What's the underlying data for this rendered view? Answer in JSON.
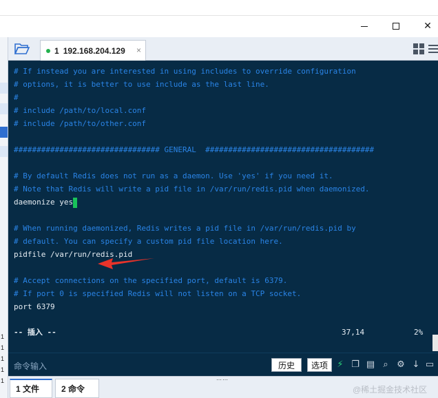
{
  "window": {
    "minimize_label": "—",
    "maximize_label": "☐",
    "close_label": "✕"
  },
  "tabbar": {
    "folder_icon": "folder-open-icon",
    "session_tab": {
      "number": "1",
      "title": "192.168.204.129",
      "status": "connected",
      "close": "×"
    },
    "layout_icon": "grid-icon",
    "menu_icon": "menu-icon"
  },
  "terminal": {
    "lines": [
      {
        "text": "# If instead you are interested in using includes to override configuration",
        "kind": "comment"
      },
      {
        "text": "# options, it is better to use include as the last line.",
        "kind": "comment"
      },
      {
        "text": "#",
        "kind": "comment"
      },
      {
        "text": "# include /path/to/local.conf",
        "kind": "comment"
      },
      {
        "text": "# include /path/to/other.conf",
        "kind": "comment"
      },
      {
        "text": "",
        "kind": "code"
      },
      {
        "text": "################################ GENERAL  #####################################",
        "kind": "comment"
      },
      {
        "text": "",
        "kind": "code"
      },
      {
        "text": "# By default Redis does not run as a daemon. Use 'yes' if you need it.",
        "kind": "comment"
      },
      {
        "text": "# Note that Redis will write a pid file in /var/run/redis.pid when daemonized.",
        "kind": "comment"
      },
      {
        "text": "daemonize yes",
        "kind": "code"
      },
      {
        "text": "",
        "kind": "code"
      },
      {
        "text": "# When running daemonized, Redis writes a pid file in /var/run/redis.pid by",
        "kind": "comment"
      },
      {
        "text": "# default. You can specify a custom pid file location here.",
        "kind": "comment"
      },
      {
        "text": "pidfile /var/run/redis.pid",
        "kind": "code"
      },
      {
        "text": "",
        "kind": "code"
      },
      {
        "text": "# Accept connections on the specified port, default is 6379.",
        "kind": "comment"
      },
      {
        "text": "# If port 0 is specified Redis will not listen on a TCP socket.",
        "kind": "comment"
      },
      {
        "text": "port 6379",
        "kind": "code"
      }
    ],
    "status": {
      "mode": "-- 插入 --",
      "position": "37,14",
      "percent": "2%"
    },
    "colors": {
      "background": "#072b45",
      "comment": "#2a84e6",
      "text": "#e6edf3",
      "cursor": "#19c25a",
      "arrow": "#e8332a"
    }
  },
  "command_bar": {
    "placeholder": "命令输入",
    "history_button": "历史",
    "options_button": "选项",
    "icons": [
      "lightning-icon",
      "copy-icon",
      "paste-icon",
      "search-icon",
      "gear-icon",
      "download-icon",
      "window-icon"
    ]
  },
  "bottom_tabs": {
    "drag_handle": "⋯⋯",
    "files_tab": "1 文件",
    "commands_tab": "2 命令",
    "watermark": "@稀土掘金技术社区"
  },
  "left_strip": {
    "digits": [
      "1",
      "1",
      "1",
      "1",
      "1"
    ]
  }
}
